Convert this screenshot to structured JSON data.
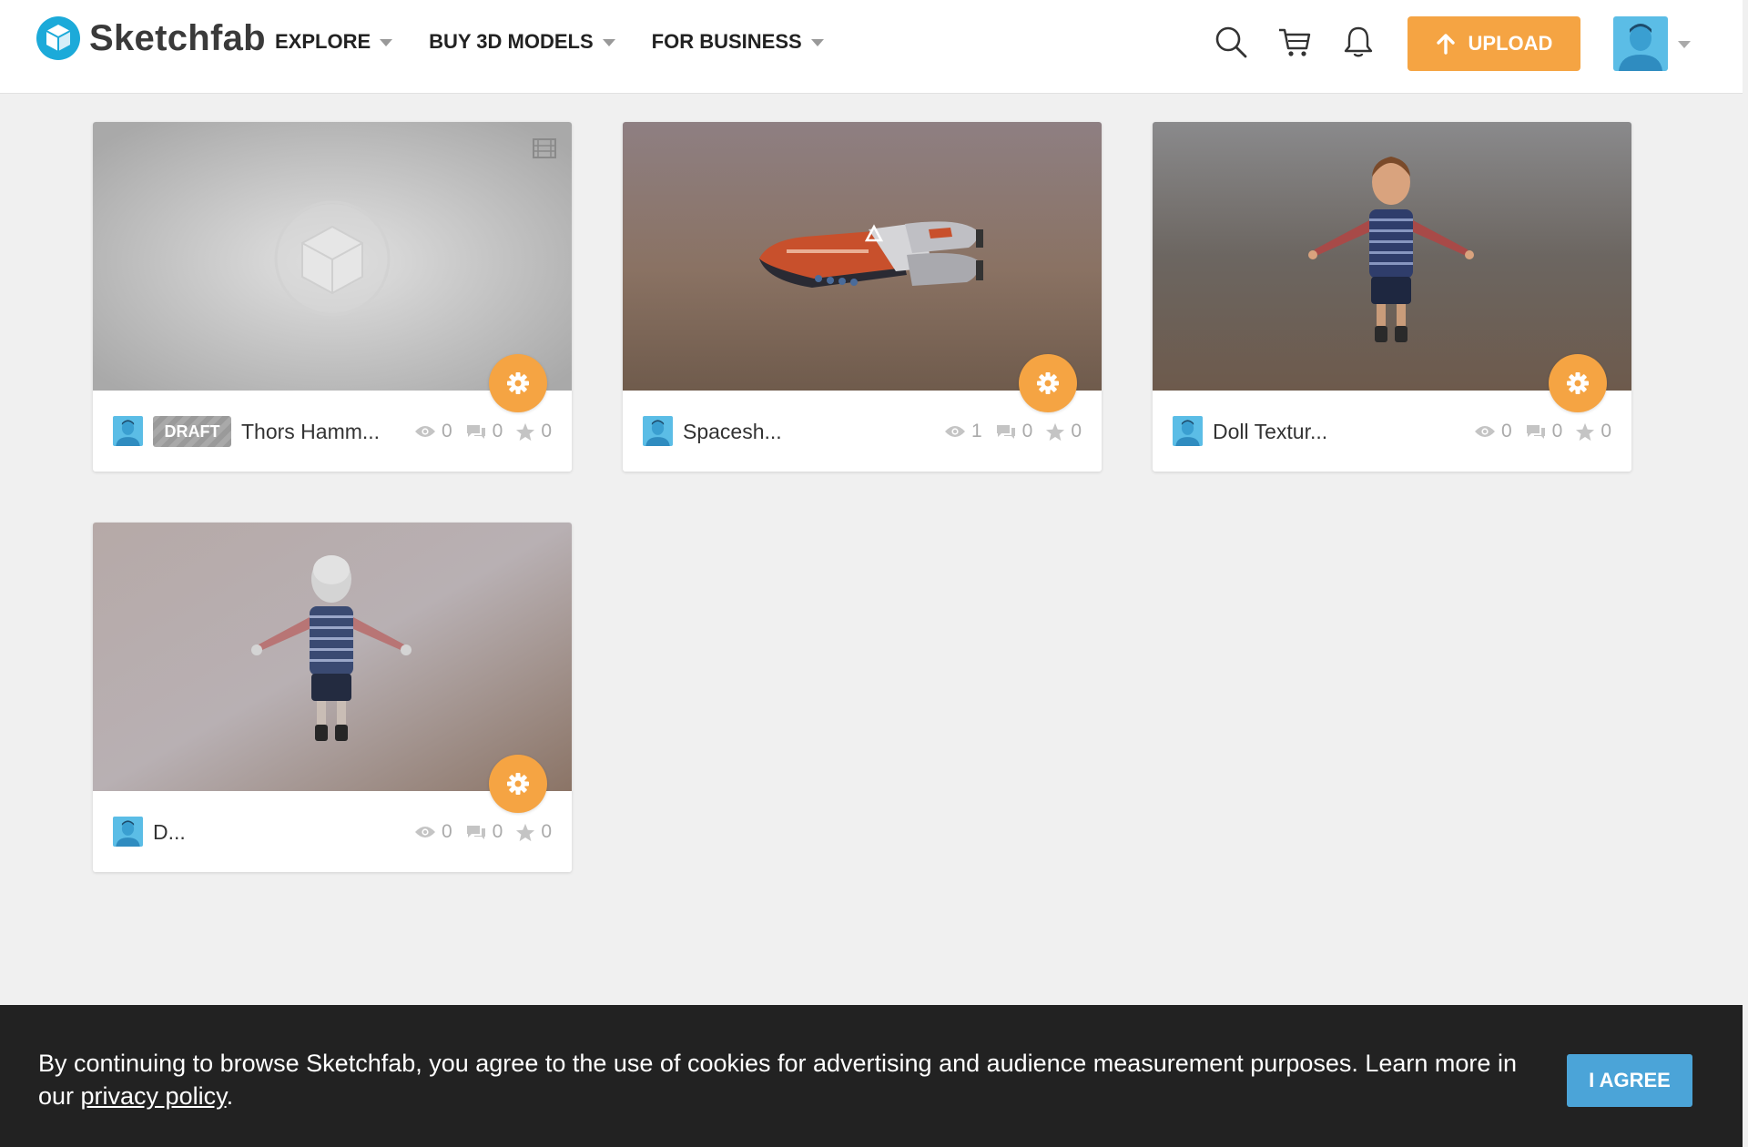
{
  "header": {
    "logo_text": "Sketchfab",
    "nav": [
      {
        "label": "EXPLORE"
      },
      {
        "label": "BUY 3D MODELS"
      },
      {
        "label": "FOR BUSINESS"
      }
    ],
    "icons": [
      "search-icon",
      "cart-icon",
      "bell-icon"
    ],
    "upload_label": "UPLOAD",
    "accent_color": "#f5a443"
  },
  "models": [
    {
      "title": "Thors Hamm...",
      "draft": "DRAFT",
      "views": "0",
      "comments": "0",
      "likes": "0",
      "thumbnail": "placeholder"
    },
    {
      "title": "Spacesh...",
      "views": "1",
      "comments": "0",
      "likes": "0",
      "thumbnail": "spaceship"
    },
    {
      "title": "Doll Textur...",
      "views": "0",
      "comments": "0",
      "likes": "0",
      "thumbnail": "textured-doll"
    },
    {
      "title": "D...",
      "views": "0",
      "comments": "0",
      "likes": "0",
      "thumbnail": "untextured-doll"
    }
  ],
  "cookie": {
    "text": "By continuing to browse Sketchfab, you agree to the use of cookies for advertising and audience measurement purposes. Learn more in our ",
    "link": "privacy policy",
    "end": ".",
    "button": "I AGREE",
    "button_color": "#4ba4d8"
  }
}
